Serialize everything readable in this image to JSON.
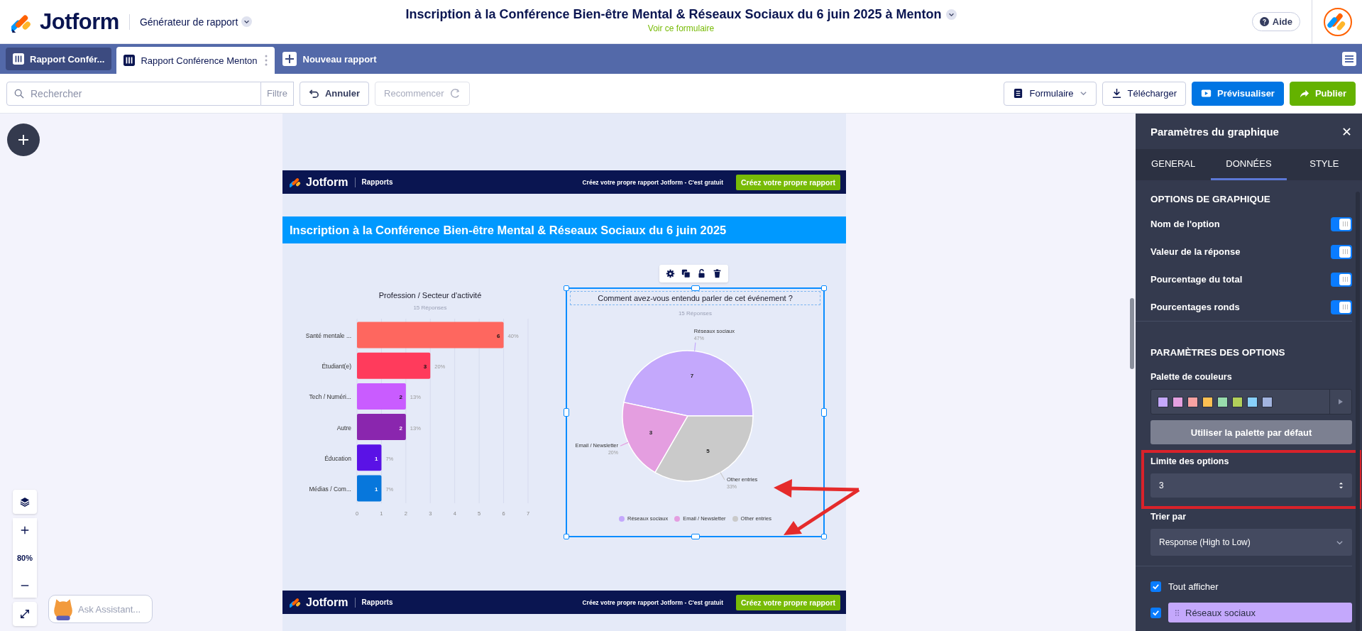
{
  "header": {
    "logo": "Jotform",
    "app_menu": "Générateur de rapport",
    "title": "Inscription à la Conférence Bien-être Mental & Réseaux Sociaux du 6 juin 2025 à Menton",
    "form_link": "Voir ce formulaire",
    "help": "Aide"
  },
  "tabs": [
    {
      "label": "Rapport Confér...",
      "selected": false
    },
    {
      "label": "Rapport Conférence Menton",
      "selected": true
    }
  ],
  "new_tab": "Nouveau rapport",
  "toolbar": {
    "search": {
      "placeholder": "Rechercher"
    },
    "filter": "Filtre",
    "undo": {
      "label": "Annuler",
      "disabled": false
    },
    "redo": {
      "label": "Recommencer",
      "disabled": true
    },
    "form_menu": "Formulaire",
    "download": "Télécharger",
    "preview": "Prévisualiser",
    "publish": "Publier"
  },
  "zoom": {
    "reading": "80%"
  },
  "assistant": {
    "placeholder": "Ask Assistant..."
  },
  "report": {
    "banner_top": {
      "logo": "Jotform",
      "section": "Rapports",
      "tagline": "Créez votre propre rapport Jotform - C'est gratuit",
      "cta": "Créez votre propre rapport"
    },
    "title": "Inscription à la Conférence Bien-être Mental & Réseaux Sociaux du 6 juin 2025",
    "bar_chart": {
      "subtitle": "15 Réponses",
      "bars": [
        {
          "color": "#fe675f",
          "percent": "40%"
        },
        {
          "color": "#ff3b5c",
          "percent": "20%"
        },
        {
          "color": "#c95cff",
          "percent": "13%"
        },
        {
          "color": "#8a26ae",
          "percent": "13%"
        },
        {
          "color": "#5a12e6",
          "percent": "7%"
        },
        {
          "color": "#0777dc",
          "percent": "7%"
        }
      ],
      "chart_data": {
        "type": "bar",
        "orientation": "horizontal",
        "title": "Profession / Secteur d'activité",
        "categories": [
          "Santé mentale ...",
          "Étudiant(e)",
          "Tech / Numéri...",
          "Autre",
          "Éducation",
          "Médias / Com..."
        ],
        "series": [
          {
            "values": [
              6,
              3,
              2,
              2,
              1,
              1
            ]
          }
        ],
        "xlim": [
          0,
          7
        ],
        "xticks": [
          0,
          1,
          2,
          3,
          4,
          5,
          6,
          7
        ],
        "data_labels": true,
        "grid": true
      }
    },
    "pie_chart": {
      "selected": true,
      "subtitle": "15 Réponses",
      "legend": [
        {
          "label": "Réseaux sociaux",
          "color": "#c4a8fc"
        },
        {
          "label": "Email / Newsletter",
          "color": "#e49ee0"
        },
        {
          "label": "Other entries",
          "color": "#cacaca"
        }
      ],
      "slice_percents": [
        "47%",
        "20%",
        "33%"
      ],
      "chart_data": {
        "type": "pie",
        "title": "Comment avez-vous entendu parler de cet événement ?",
        "categories": [
          "Réseaux sociaux",
          "Email / Newsletter",
          "Other entries"
        ],
        "series": [
          {
            "values": [
              7,
              3,
              5
            ]
          }
        ],
        "data_labels": true
      }
    },
    "banner_bottom": {
      "logo": "Jotform",
      "section": "Rapports",
      "tagline": "Créez votre propre rapport Jotform - C'est gratuit",
      "cta": "Créez votre propre rapport"
    }
  },
  "panel": {
    "title": "Paramètres du graphique",
    "tabs": [
      {
        "label": "GENERAL",
        "selected": false
      },
      {
        "label": "DONNÉES",
        "selected": true
      },
      {
        "label": "STYLE",
        "selected": false
      }
    ],
    "chart_options_title": "OPTIONS DE GRAPHIQUE",
    "toggles": [
      {
        "label": "Nom de l'option",
        "on": true
      },
      {
        "label": "Valeur de la réponse",
        "on": true
      },
      {
        "label": "Pourcentage du total",
        "on": true
      },
      {
        "label": "Pourcentages ronds",
        "on": true
      }
    ],
    "option_settings_title": "PARAMÈTRES DES OPTIONS",
    "palette_label": "Palette de couleurs",
    "palette": [
      {
        "color": "#c4a8fc"
      },
      {
        "color": "#e4a0e0"
      },
      {
        "color": "#f8a2a2"
      },
      {
        "color": "#fdc052"
      },
      {
        "color": "#98dcac"
      },
      {
        "color": "#b2d05a"
      },
      {
        "color": "#88d0fa"
      },
      {
        "color": "#a2b4e0"
      }
    ],
    "default_palette_button": "Utiliser la palette par défaut",
    "limit": {
      "label": "Limite des options",
      "value": "3"
    },
    "sort": {
      "label": "Trier par",
      "value": "Response (High to Low)"
    },
    "show_all": {
      "label": "Tout afficher",
      "checked": true
    },
    "options": [
      {
        "label": "Réseaux sociaux",
        "checked": true,
        "color": "#c4a8fc"
      }
    ]
  }
}
